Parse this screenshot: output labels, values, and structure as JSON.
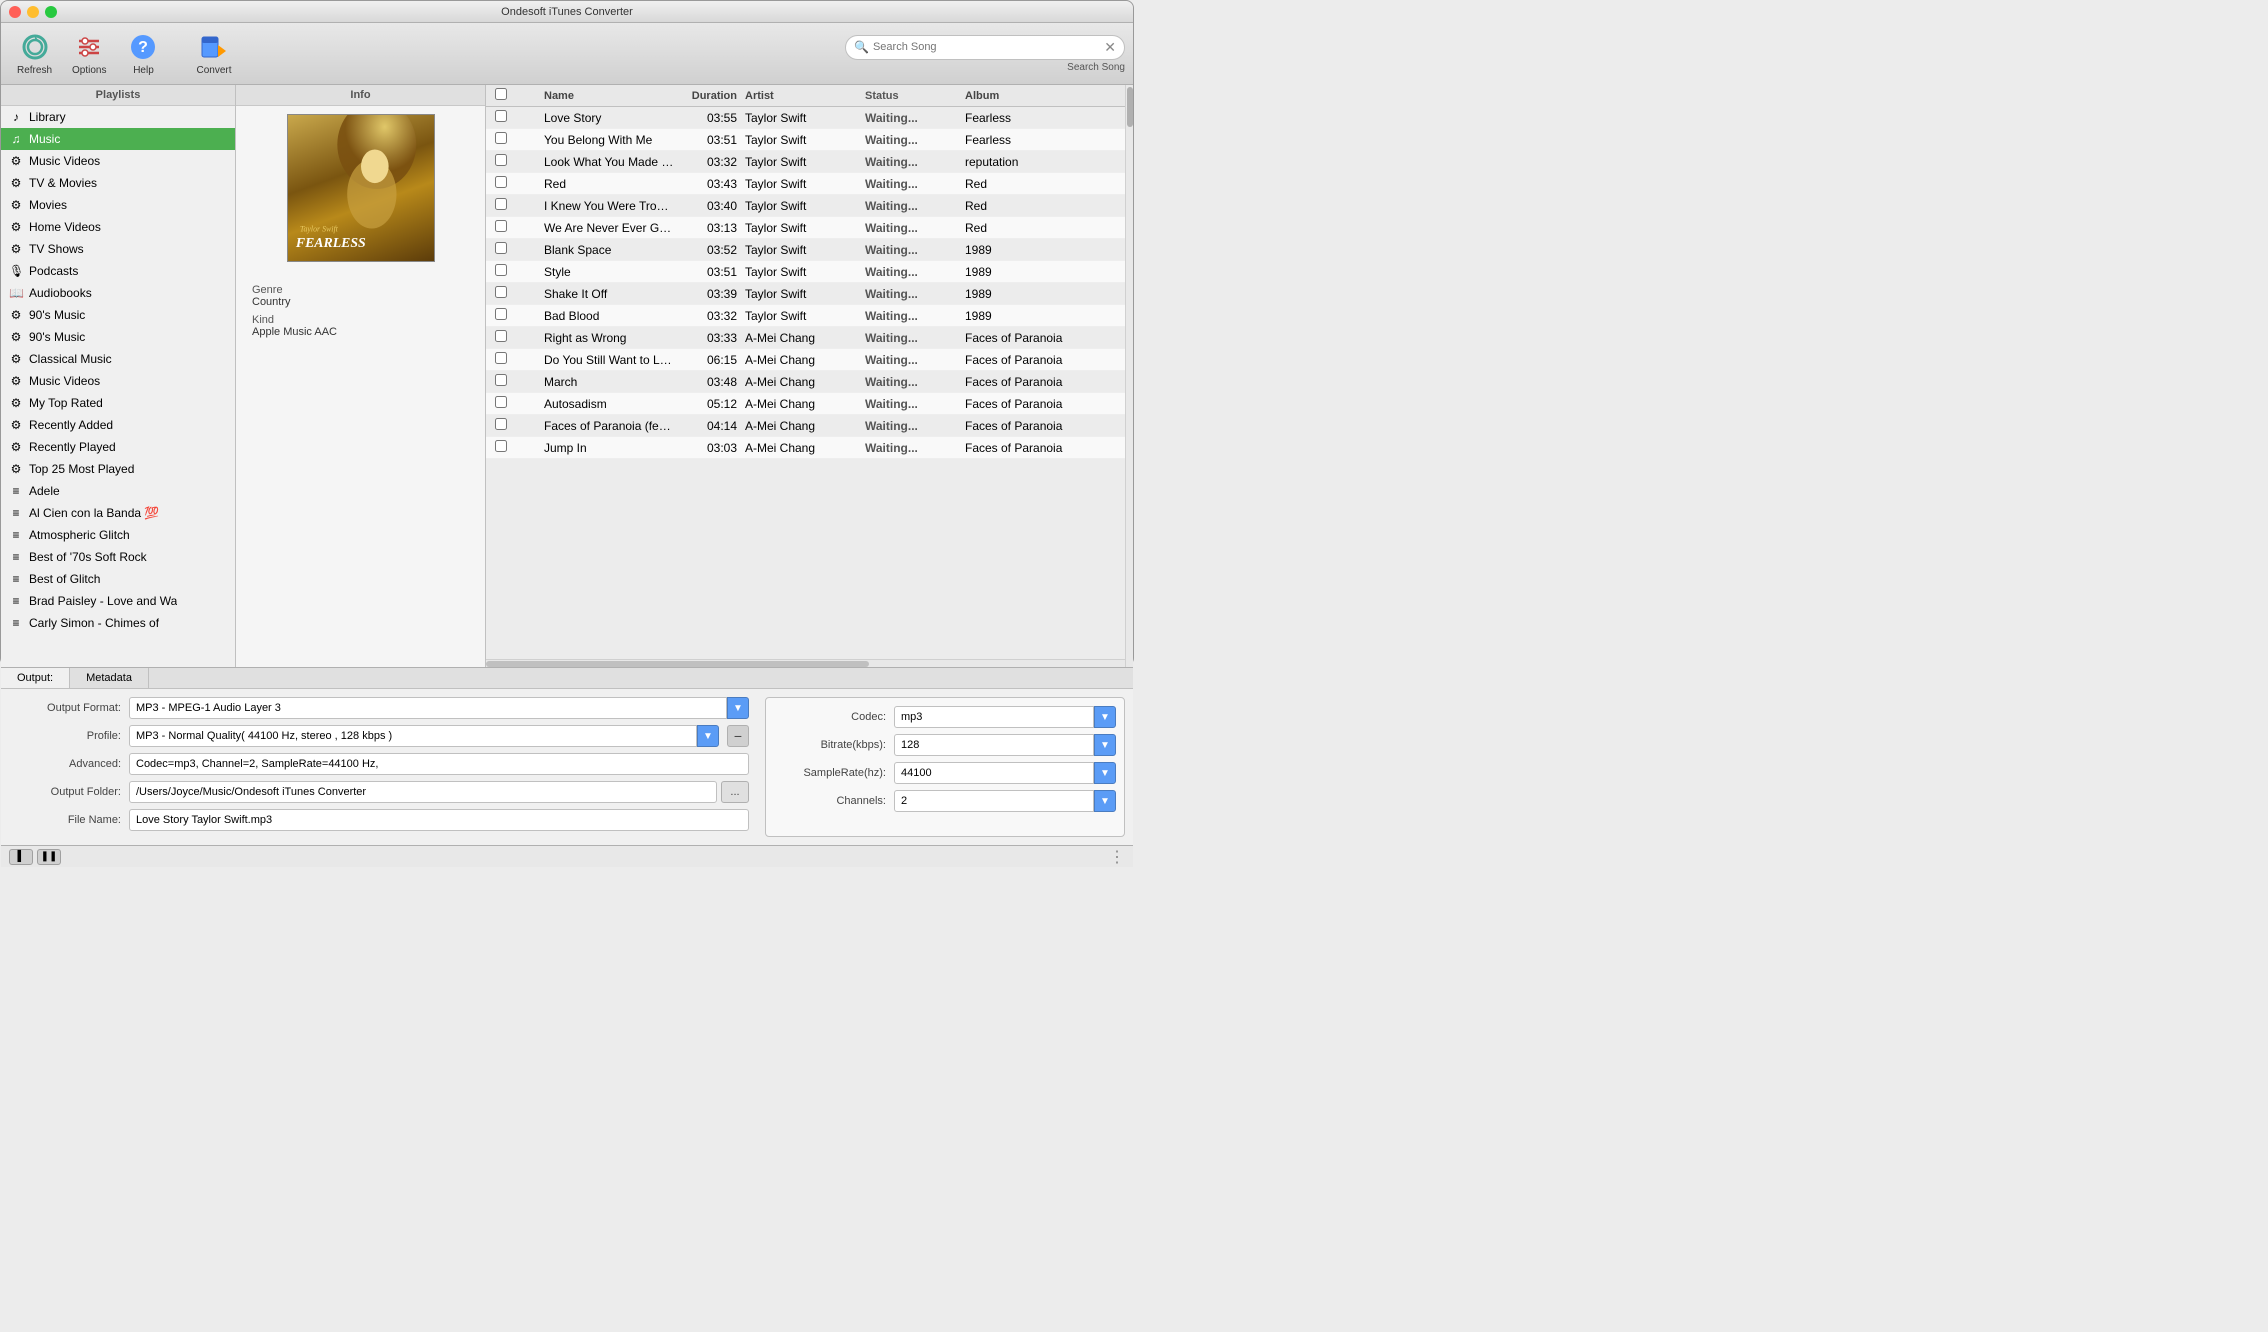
{
  "window": {
    "title": "Ondesoft iTunes Converter"
  },
  "titlebar": {
    "buttons": {
      "close": "×",
      "minimize": "−",
      "maximize": "+"
    }
  },
  "toolbar": {
    "refresh_label": "Refresh",
    "options_label": "Options",
    "help_label": "Help",
    "convert_label": "Convert",
    "search_placeholder": "Search Song",
    "search_label": "Search Song"
  },
  "sidebar": {
    "header": "Playlists",
    "items": [
      {
        "icon": "♪",
        "label": "Library",
        "active": false
      },
      {
        "icon": "♫",
        "label": "Music",
        "active": true
      },
      {
        "icon": "⚙",
        "label": "Music Videos",
        "active": false
      },
      {
        "icon": "⚙",
        "label": "TV & Movies",
        "active": false
      },
      {
        "icon": "⚙",
        "label": "Movies",
        "active": false
      },
      {
        "icon": "⚙",
        "label": "Home Videos",
        "active": false
      },
      {
        "icon": "⚙",
        "label": "TV Shows",
        "active": false
      },
      {
        "icon": "🎙",
        "label": "Podcasts",
        "active": false
      },
      {
        "icon": "📖",
        "label": "Audiobooks",
        "active": false
      },
      {
        "icon": "⚙",
        "label": "90's Music",
        "active": false
      },
      {
        "icon": "⚙",
        "label": "90's Music",
        "active": false
      },
      {
        "icon": "⚙",
        "label": "Classical Music",
        "active": false
      },
      {
        "icon": "⚙",
        "label": "Music Videos",
        "active": false
      },
      {
        "icon": "⚙",
        "label": "My Top Rated",
        "active": false
      },
      {
        "icon": "⚙",
        "label": "Recently Added",
        "active": false
      },
      {
        "icon": "⚙",
        "label": "Recently Played",
        "active": false
      },
      {
        "icon": "⚙",
        "label": "Top 25 Most Played",
        "active": false
      },
      {
        "icon": "≡",
        "label": "Adele",
        "active": false
      },
      {
        "icon": "≡",
        "label": "Al Cien con la Banda 💯",
        "active": false
      },
      {
        "icon": "≡",
        "label": "Atmospheric Glitch",
        "active": false
      },
      {
        "icon": "≡",
        "label": "Best of '70s Soft Rock",
        "active": false
      },
      {
        "icon": "≡",
        "label": "Best of Glitch",
        "active": false
      },
      {
        "icon": "≡",
        "label": "Brad Paisley - Love and Wa",
        "active": false
      },
      {
        "icon": "≡",
        "label": "Carly Simon - Chimes of",
        "active": false
      }
    ]
  },
  "info_panel": {
    "header": "Info",
    "album_artist": "Taylor Swift",
    "album_title": "FEARLESS",
    "genre_label": "Genre",
    "genre_value": "Country",
    "kind_label": "Kind",
    "kind_value": "Apple Music AAC"
  },
  "song_list": {
    "columns": {
      "name": "Name",
      "duration": "Duration",
      "artist": "Artist",
      "status": "Status",
      "album": "Album"
    },
    "songs": [
      {
        "name": "Love Story",
        "duration": "03:55",
        "artist": "Taylor Swift",
        "status": "Waiting...",
        "album": "Fearless"
      },
      {
        "name": "You Belong With Me",
        "duration": "03:51",
        "artist": "Taylor Swift",
        "status": "Waiting...",
        "album": "Fearless"
      },
      {
        "name": "Look What You Made Me Do",
        "duration": "03:32",
        "artist": "Taylor Swift",
        "status": "Waiting...",
        "album": "reputation"
      },
      {
        "name": "Red",
        "duration": "03:43",
        "artist": "Taylor Swift",
        "status": "Waiting...",
        "album": "Red"
      },
      {
        "name": "I Knew You Were Trouble",
        "duration": "03:40",
        "artist": "Taylor Swift",
        "status": "Waiting...",
        "album": "Red"
      },
      {
        "name": "We Are Never Ever Getting Back Tog...",
        "duration": "03:13",
        "artist": "Taylor Swift",
        "status": "Waiting...",
        "album": "Red"
      },
      {
        "name": "Blank Space",
        "duration": "03:52",
        "artist": "Taylor Swift",
        "status": "Waiting...",
        "album": "1989"
      },
      {
        "name": "Style",
        "duration": "03:51",
        "artist": "Taylor Swift",
        "status": "Waiting...",
        "album": "1989"
      },
      {
        "name": "Shake It Off",
        "duration": "03:39",
        "artist": "Taylor Swift",
        "status": "Waiting...",
        "album": "1989"
      },
      {
        "name": "Bad Blood",
        "duration": "03:32",
        "artist": "Taylor Swift",
        "status": "Waiting...",
        "album": "1989"
      },
      {
        "name": "Right as Wrong",
        "duration": "03:33",
        "artist": "A-Mei Chang",
        "status": "Waiting...",
        "album": "Faces of Paranoia"
      },
      {
        "name": "Do You Still Want to Love Me",
        "duration": "06:15",
        "artist": "A-Mei Chang",
        "status": "Waiting...",
        "album": "Faces of Paranoia"
      },
      {
        "name": "March",
        "duration": "03:48",
        "artist": "A-Mei Chang",
        "status": "Waiting...",
        "album": "Faces of Paranoia"
      },
      {
        "name": "Autosadism",
        "duration": "05:12",
        "artist": "A-Mei Chang",
        "status": "Waiting...",
        "album": "Faces of Paranoia"
      },
      {
        "name": "Faces of Paranoia (feat. Soft Lipa)",
        "duration": "04:14",
        "artist": "A-Mei Chang",
        "status": "Waiting...",
        "album": "Faces of Paranoia"
      },
      {
        "name": "Jump In",
        "duration": "03:03",
        "artist": "A-Mei Chang",
        "status": "Waiting...",
        "album": "Faces of Paranoia"
      }
    ]
  },
  "bottom_panel": {
    "tabs": [
      {
        "label": "Output:",
        "active": true
      },
      {
        "label": "Metadata",
        "active": false
      }
    ],
    "output_format_label": "Output Format:",
    "output_format_value": "MP3 - MPEG-1 Audio Layer 3",
    "profile_label": "Profile:",
    "profile_value": "MP3 - Normal Quality( 44100 Hz, stereo , 128 kbps )",
    "advanced_label": "Advanced:",
    "advanced_value": "Codec=mp3, Channel=2, SampleRate=44100 Hz,",
    "output_folder_label": "Output Folder:",
    "output_folder_value": "/Users/Joyce/Music/Ondesoft iTunes Converter",
    "file_name_label": "File Name:",
    "file_name_value": "Love Story Taylor Swift.mp3"
  },
  "settings": {
    "codec_label": "Codec:",
    "codec_value": "mp3",
    "bitrate_label": "Bitrate(kbps):",
    "bitrate_value": "128",
    "samplerate_label": "SampleRate(hz):",
    "samplerate_value": "44100",
    "channels_label": "Channels:",
    "channels_value": "2"
  },
  "statusbar": {
    "pause_icon": "❚❚",
    "play_icon": "❚",
    "resize_icon": "⋮"
  }
}
